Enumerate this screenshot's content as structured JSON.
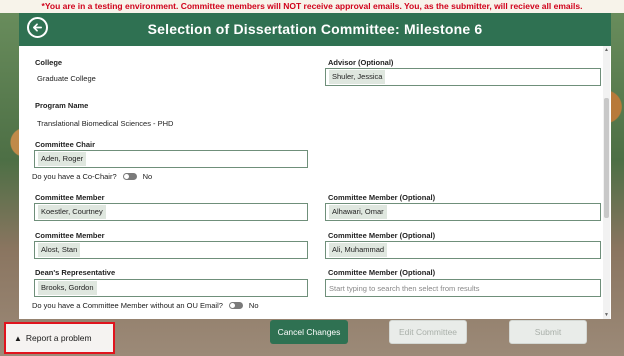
{
  "banner": "*You are in a testing environment. Committee members will NOT receive approval emails. You, as the submitter, will recieve all emails.",
  "header": {
    "title": "Selection of Dissertation Committee: Milestone 6",
    "back_icon": "arrow-left-icon"
  },
  "form": {
    "college": {
      "label": "College",
      "value": "Graduate College"
    },
    "advisor": {
      "label": "Advisor (Optional)",
      "value": "Shuler, Jessica"
    },
    "program": {
      "label": "Program Name",
      "value": "Translational Biomedical Sciences - PHD"
    },
    "chair": {
      "label": "Committee Chair",
      "value": "Aden, Roger"
    },
    "cochair": {
      "label": "Do you have a Co-Chair?",
      "state": "No"
    },
    "member1": {
      "label": "Committee Member",
      "value": "Koestler, Courtney"
    },
    "opt1": {
      "label": "Committee Member (Optional)",
      "value": "Alhawari, Omar"
    },
    "member2": {
      "label": "Committee Member",
      "value": "Alost, Stan"
    },
    "opt2": {
      "label": "Committee Member (Optional)",
      "value": "Ali, Muhammad"
    },
    "deans": {
      "label": "Dean's Representative",
      "value": "Brooks, Gordon"
    },
    "opt3": {
      "label": "Committee Member (Optional)",
      "placeholder": "Start typing to search then select from results"
    },
    "no_email": {
      "label": "Do you have a Committee Member without an OU Email?",
      "state": "No"
    }
  },
  "footer": {
    "report": "Report a problem",
    "cancel": "Cancel Changes",
    "edit": "Edit Committee",
    "submit": "Submit"
  },
  "colors": {
    "header": "#2f7152",
    "banner_text": "#d0021b",
    "highlight": "#e0141e"
  }
}
